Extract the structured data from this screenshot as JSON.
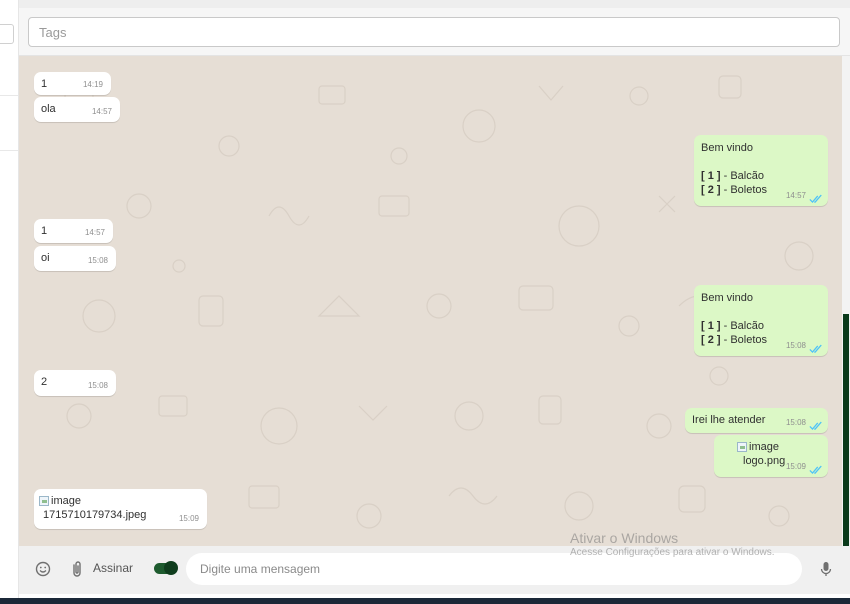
{
  "tags_input": {
    "placeholder": "Tags"
  },
  "messages": [
    {
      "text": "1",
      "time": "14:19"
    },
    {
      "text": "ola",
      "time": "14:57"
    },
    {
      "line1": "Bem vindo",
      "opt1_key": "[ 1 ]",
      "opt1_label": " - Balcão",
      "opt2_key": "[ 2 ]",
      "opt2_label": " - Boletos",
      "time": "14:57"
    },
    {
      "text": "1",
      "time": "14:57"
    },
    {
      "text": "oi",
      "time": "15:08"
    },
    {
      "line1": "Bem vindo",
      "opt1_key": "[ 1 ]",
      "opt1_label": " - Balcão",
      "opt2_key": "[ 2 ]",
      "opt2_label": " - Boletos",
      "time": "15:08"
    },
    {
      "text": "2",
      "time": "15:08"
    },
    {
      "text": "Irei lhe atender",
      "time": "15:08"
    },
    {
      "alt": "image",
      "filename": "logo.png",
      "time": "15:09"
    },
    {
      "alt": "image",
      "filename": "1715710179734.jpeg",
      "time": "15:09"
    }
  ],
  "watermark": {
    "title": "Ativar o Windows",
    "subtitle": "Acesse Configurações para ativar o Windows."
  },
  "composer": {
    "emoji_icon": "smiley-icon",
    "attach_icon": "paperclip-icon",
    "sign_label": "Assinar",
    "sign_enabled": true,
    "placeholder": "Digite uma mensagem",
    "mic_icon": "microphone-icon"
  },
  "colors": {
    "incoming_bubble": "#ffffff",
    "outgoing_bubble": "#dcf8c6",
    "chat_background": "#e6ded5",
    "read_tick": "#4fc3f7",
    "toggle": "#1e5b2e"
  }
}
